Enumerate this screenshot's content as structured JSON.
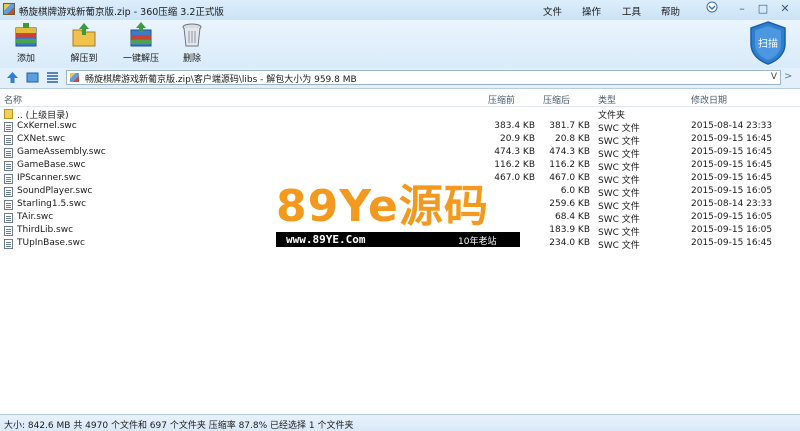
{
  "window": {
    "title": "畅旋棋牌游戏新葡京版.zip - 360压缩 3.2正式版",
    "menu": [
      "文件",
      "操作",
      "工具",
      "帮助"
    ]
  },
  "toolbar": {
    "buttons": [
      {
        "label": "添加",
        "icon": "add-archive-icon"
      },
      {
        "label": "解压到",
        "icon": "extract-to-icon"
      },
      {
        "label": "一键解压",
        "icon": "one-click-extract-icon"
      },
      {
        "label": "删除",
        "icon": "delete-trash-icon"
      }
    ],
    "scan_label": "扫描"
  },
  "address": {
    "path": "畅旋棋牌游戏新葡京版.zip\\客户端源码\\libs - 解包大小为 959.8 MB",
    "dropdown": "V",
    "go": ">"
  },
  "columns": {
    "name": "名称",
    "size": "压缩前",
    "packed": "压缩后",
    "type": "类型",
    "modified": "修改日期"
  },
  "files": [
    {
      "name": ".. (上级目录)",
      "size": "",
      "packed": "",
      "type": "文件夹",
      "modified": "",
      "kind": "folder"
    },
    {
      "name": "CxKernel.swc",
      "size": "383.4 KB",
      "packed": "381.7 KB",
      "type": "SWC 文件",
      "modified": "2015-08-14 23:33",
      "kind": "file"
    },
    {
      "name": "CXNet.swc",
      "size": "20.9 KB",
      "packed": "20.8 KB",
      "type": "SWC 文件",
      "modified": "2015-09-15 16:45",
      "kind": "file"
    },
    {
      "name": "GameAssembly.swc",
      "size": "474.3 KB",
      "packed": "474.3 KB",
      "type": "SWC 文件",
      "modified": "2015-09-15 16:45",
      "kind": "file"
    },
    {
      "name": "GameBase.swc",
      "size": "116.2 KB",
      "packed": "116.2 KB",
      "type": "SWC 文件",
      "modified": "2015-09-15 16:45",
      "kind": "file"
    },
    {
      "name": "IPScanner.swc",
      "size": "467.0 KB",
      "packed": "467.0 KB",
      "type": "SWC 文件",
      "modified": "2015-09-15 16:45",
      "kind": "file"
    },
    {
      "name": "SoundPlayer.swc",
      "size": "",
      "packed": "6.0 KB",
      "type": "SWC 文件",
      "modified": "2015-09-15 16:05",
      "kind": "file"
    },
    {
      "name": "Starling1.5.swc",
      "size": "",
      "packed": "259.6 KB",
      "type": "SWC 文件",
      "modified": "2015-08-14 23:33",
      "kind": "file"
    },
    {
      "name": "TAir.swc",
      "size": "",
      "packed": "68.4 KB",
      "type": "SWC 文件",
      "modified": "2015-09-15 16:05",
      "kind": "file"
    },
    {
      "name": "ThirdLib.swc",
      "size": "",
      "packed": "183.9 KB",
      "type": "SWC 文件",
      "modified": "2015-09-15 16:05",
      "kind": "file"
    },
    {
      "name": "TUpInBase.swc",
      "size": "",
      "packed": "234.0 KB",
      "type": "SWC 文件",
      "modified": "2015-09-15 16:45",
      "kind": "file"
    }
  ],
  "watermark": {
    "big_text": "89Ye源码",
    "url": "www.89YE.Com",
    "slogan": "10年老站"
  },
  "status": {
    "text": "大小: 842.6 MB 共 4970 个文件和 697 个文件夹 压缩率 87.8% 已经选择 1 个文件夹"
  },
  "colors": {
    "accent": "#2f7fd0",
    "watermark_orange": "#f39a1e"
  }
}
